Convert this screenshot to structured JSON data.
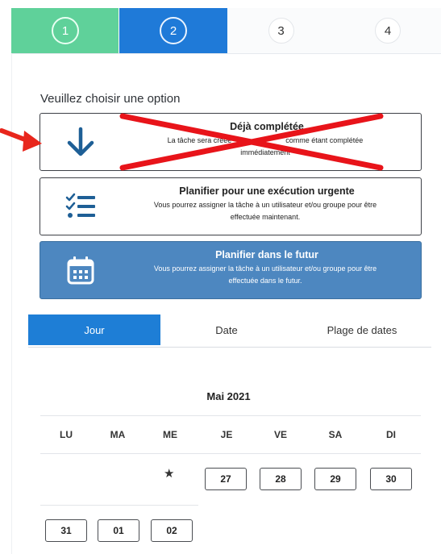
{
  "stepper": {
    "steps": [
      {
        "label": "1",
        "state": "completed",
        "color": "#5fd19a"
      },
      {
        "label": "2",
        "state": "active",
        "color": "#1f7ad8"
      },
      {
        "label": "3",
        "state": "pending"
      },
      {
        "label": "4",
        "state": "pending"
      }
    ]
  },
  "prompt": "Veuillez choisir une option",
  "options": [
    {
      "icon": "arrow-down-icon",
      "title": "Déjà complétée",
      "desc_left": "La tâche sera créée",
      "desc_right": "comme étant complétée",
      "desc_line2": "immédiatement",
      "crossed_out": true
    },
    {
      "icon": "checklist-icon",
      "title": "Planifier pour une exécution urgente",
      "desc_line1": "Vous pourrez assigner la tâche à un utilisateur et/ou groupe pour être",
      "desc_line2": "effectuée maintenant."
    },
    {
      "icon": "calendar-icon",
      "title": "Planifier dans le futur",
      "desc_line1": "Vous pourrez assigner la tâche à un utilisateur et/ou groupe pour être",
      "desc_line2": "effectuée dans le futur.",
      "selected": true
    }
  ],
  "annotation_colors": {
    "arrow": "#e8261c",
    "cross": "#e8141a"
  },
  "tabs": [
    {
      "label": "Jour",
      "active": true
    },
    {
      "label": "Date"
    },
    {
      "label": "Plage de dates"
    }
  ],
  "calendar": {
    "month": "Mai 2021",
    "weekdays": [
      "LU",
      "MA",
      "ME",
      "JE",
      "VE",
      "SA",
      "DI"
    ],
    "week1": [
      "27",
      "28",
      "29",
      "30"
    ],
    "week2": [
      "31",
      "01",
      "02"
    ]
  }
}
